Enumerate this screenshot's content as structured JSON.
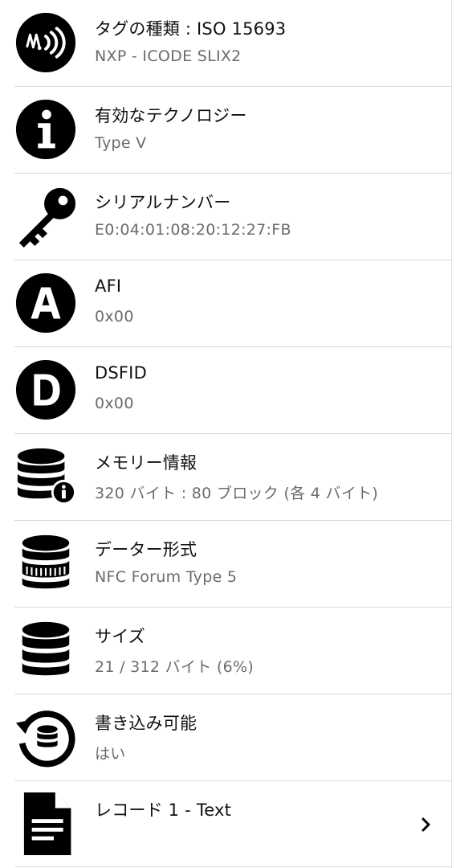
{
  "rows": [
    {
      "title": "タグの種類 : ISO 15693",
      "value": "NXP - ICODE SLIX2",
      "icon": "nfc-icon"
    },
    {
      "title": "有効なテクノロジー",
      "value": "Type V",
      "icon": "info-icon"
    },
    {
      "title": "シリアルナンバー",
      "value": "E0:04:01:08:20:12:27:FB",
      "icon": "key-icon"
    },
    {
      "title": "AFI",
      "value": "0x00",
      "icon": "letter-a-icon"
    },
    {
      "title": "DSFID",
      "value": "0x00",
      "icon": "letter-d-icon"
    },
    {
      "title": "メモリー情報",
      "value": "320 バイト : 80 ブロック (各 4 バイト)",
      "icon": "database-info-icon"
    },
    {
      "title": "データー形式",
      "value": "NFC Forum Type 5",
      "icon": "database-format-icon"
    },
    {
      "title": "サイズ",
      "value": "21 / 312 バイト (6%)",
      "icon": "database-icon"
    },
    {
      "title": "書き込み可能",
      "value": "はい",
      "icon": "database-rewrite-icon"
    },
    {
      "title": "レコード 1 - Text",
      "value": "",
      "icon": "document-icon"
    }
  ]
}
